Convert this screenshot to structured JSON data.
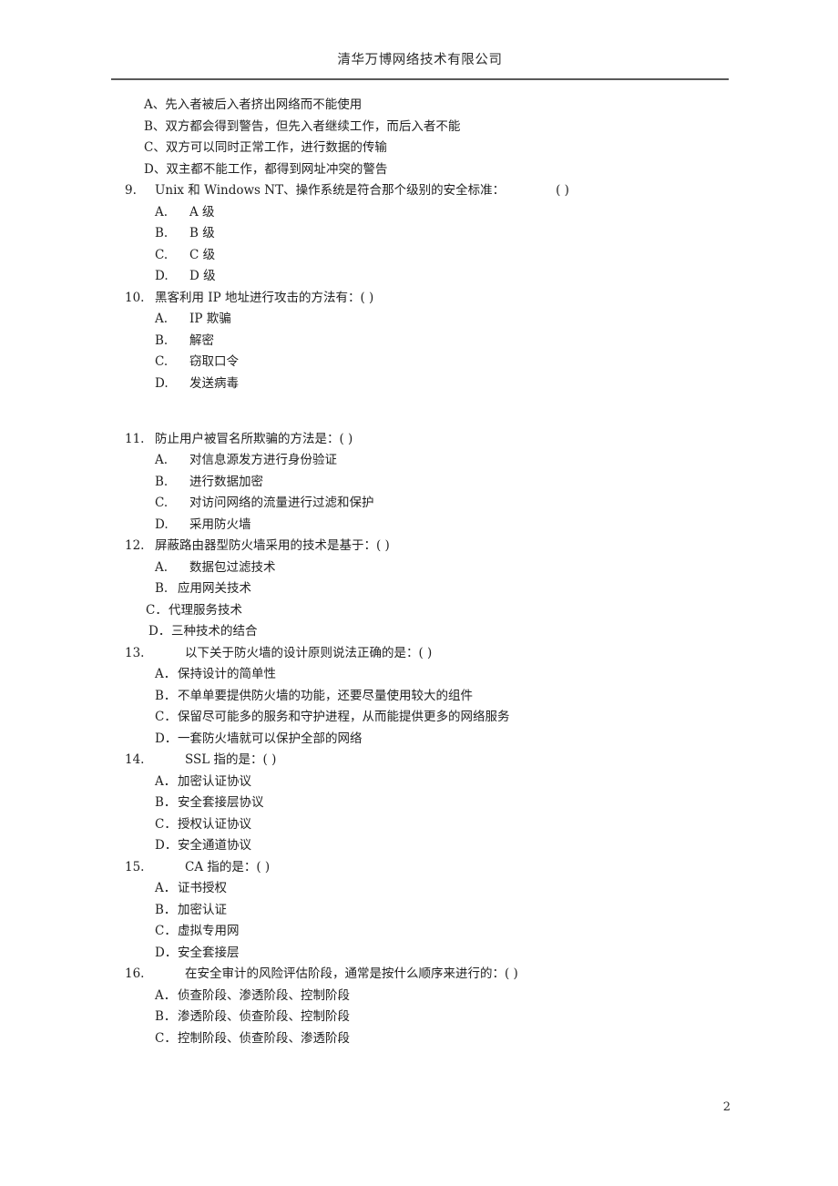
{
  "header": {
    "company": "清华万博网络技术有限公司"
  },
  "footer": {
    "page_number": "2"
  },
  "blank_paren": "（        ）",
  "carryover_options": [
    "A、先入者被后入者挤出网络而不能使用",
    "B、双方都会得到警告，但先入者继续工作，而后入者不能",
    "C、双方可以同时正常工作，进行数据的传输",
    "D、双主都不能工作，都得到网址冲突的警告"
  ],
  "questions": [
    {
      "number": "9.",
      "text": "Unix 和 Windows NT、操作系统是符合那个级别的安全标准：",
      "paren": "(        )",
      "options": [
        {
          "letter": "A.",
          "text": "A 级"
        },
        {
          "letter": "B.",
          "text": "B 级"
        },
        {
          "letter": "C.",
          "text": "C 级"
        },
        {
          "letter": "D.",
          "text": "D 级"
        }
      ]
    },
    {
      "number": "10.",
      "text": "黑客利用 IP 地址进行攻击的方法有：",
      "paren": "(      )",
      "options": [
        {
          "letter": "A.",
          "text": "IP 欺骗"
        },
        {
          "letter": "B.",
          "text": "解密"
        },
        {
          "letter": "C.",
          "text": "窃取口令"
        },
        {
          "letter": "D.",
          "text": "发送病毒"
        }
      ]
    },
    {
      "number": "11.",
      "text": "防止用户被冒名所欺骗的方法是：",
      "paren": "(      )",
      "options": [
        {
          "letter": "A.",
          "text": "对信息源发方进行身份验证"
        },
        {
          "letter": "B.",
          "text": "进行数据加密"
        },
        {
          "letter": "C.",
          "text": "对访问网络的流量进行过滤和保护"
        },
        {
          "letter": "D.",
          "text": "采用防火墙"
        }
      ]
    },
    {
      "number": "12.",
      "text": "屏蔽路由器型防火墙采用的技术是基于：",
      "paren": "(      )",
      "options": [
        {
          "letter": "A.",
          "text": "数据包过滤技术"
        },
        {
          "letter": "B.",
          "text": "应用网关技术"
        },
        {
          "letter": "C．",
          "text": "代理服务技术"
        },
        {
          "letter": "D．",
          "text": "三种技术的结合"
        }
      ]
    },
    {
      "number": "13.",
      "text": "以下关于防火墙的设计原则说法正确的是：",
      "paren": "(      )",
      "options": [
        {
          "letter": "A．",
          "text": "保持设计的简单性"
        },
        {
          "letter": "B．",
          "text": "不单单要提供防火墙的功能，还要尽量使用较大的组件"
        },
        {
          "letter": "C．",
          "text": "保留尽可能多的服务和守护进程，从而能提供更多的网络服务"
        },
        {
          "letter": "D．",
          "text": "一套防火墙就可以保护全部的网络"
        }
      ]
    },
    {
      "number": "14.",
      "text": "SSL 指的是：",
      "paren": "(      )",
      "options": [
        {
          "letter": "A．",
          "text": "加密认证协议"
        },
        {
          "letter": "B．",
          "text": "安全套接层协议"
        },
        {
          "letter": "C．",
          "text": "授权认证协议"
        },
        {
          "letter": "D．",
          "text": "安全通道协议"
        }
      ]
    },
    {
      "number": "15.",
      "text": "CA 指的是：",
      "paren": "(      )",
      "options": [
        {
          "letter": "A．",
          "text": "证书授权"
        },
        {
          "letter": "B．",
          "text": "加密认证"
        },
        {
          "letter": "C．",
          "text": "虚拟专用网"
        },
        {
          "letter": "D．",
          "text": "安全套接层"
        }
      ]
    },
    {
      "number": "16.",
      "text": "在安全审计的风险评估阶段，通常是按什么顺序来进行的：",
      "paren": "(      )",
      "options": [
        {
          "letter": "A．",
          "text": "侦查阶段、渗透阶段、控制阶段"
        },
        {
          "letter": "B．",
          "text": "渗透阶段、侦查阶段、控制阶段"
        },
        {
          "letter": "C．",
          "text": "控制阶段、侦查阶段、渗透阶段"
        }
      ]
    }
  ]
}
